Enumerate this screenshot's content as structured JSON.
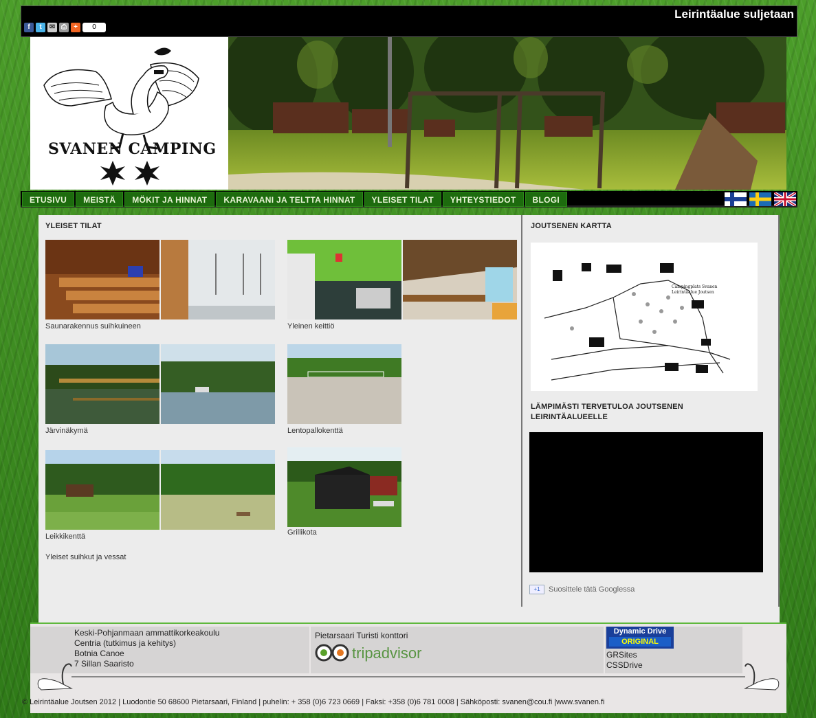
{
  "topbar": {
    "share": {
      "facebook": "f",
      "twitter": "t",
      "count": "0"
    },
    "marquee": "Leirintäalue suljetaan"
  },
  "header": {
    "logo_text": "SVANEN CAMPING"
  },
  "nav": {
    "items": [
      "ETUSIVU",
      "MEISTÄ",
      "MÖKIT JA HINNAT",
      "KARAVAANI JA TELTTA HINNAT",
      "YLEISET TILAT",
      "YHTEYSTIEDOT",
      "BLOGI"
    ]
  },
  "main": {
    "title": "YLEISET TILAT",
    "captions": {
      "sauna": "Saunarakennus suihkuineen",
      "kitchen": "Yleinen keittiö",
      "lake": "Järvinäkymä",
      "volley": "Lentopallokenttä",
      "play": "Leikkikenttä",
      "grill": "Grillikota",
      "showers": "Yleiset suihkut ja vessat"
    }
  },
  "sidebar": {
    "map_title": "JOUTSENEN KARTTA",
    "map_label_1": "Campingplats Svanen",
    "map_label_2": "Leirintäalue Joutsen",
    "welcome": "LÄMPIMÄSTI TERVETULOA JOUTSENEN LEIRINTÄALUEELLE",
    "gplus_badge": "+1",
    "gplus_text": "Suosittele tätä Googlessa"
  },
  "footer": {
    "col1": [
      "Keski-Pohjanmaan ammattikorkeakoulu",
      "Centria (tutkimus ja kehitys)",
      "Botnia Canoe",
      "7 Sillan Saaristo"
    ],
    "col2_title": "Pietarsaari Turisti konttori",
    "tripadvisor": "tripadvisor",
    "ddrive_top": "Dynamic Drive",
    "ddrive_bottom": "ORIGINAL",
    "col3": [
      "GRSites",
      "CSSDrive"
    ],
    "copyright": "© Leirintäalue Joutsen 2012 | Luodontie 50 68600 Pietarsaari, Finland | puhelin: + 358 (0)6 723 0669 | Faksi: +358 (0)6 781 0008 | Sähköposti: svanen@cou.fi |www.svanen.fi"
  }
}
